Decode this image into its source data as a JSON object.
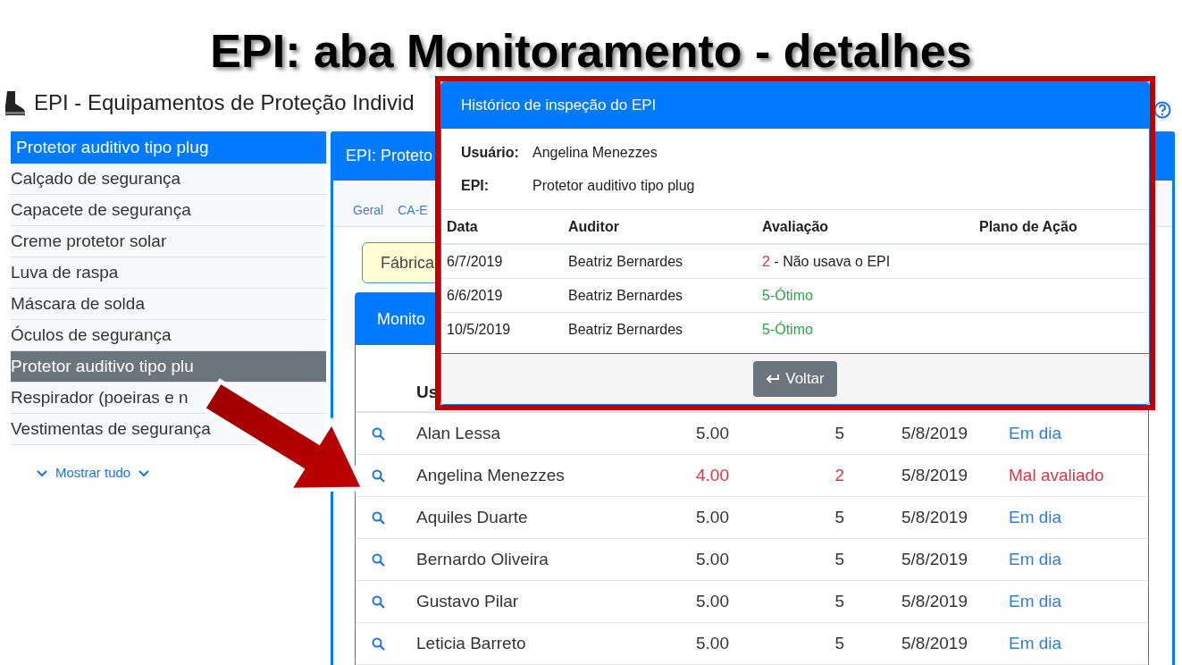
{
  "slide_title": "EPI: aba Monitoramento - detalhes",
  "app": {
    "title": "EPI - Equipamentos de Proteção Individ"
  },
  "sidebar": {
    "header": "Protetor auditivo tipo plug",
    "items": [
      {
        "label": "Calçado de segurança",
        "selected": false
      },
      {
        "label": "Capacete de segurança",
        "selected": false
      },
      {
        "label": "Creme protetor solar",
        "selected": false
      },
      {
        "label": "Luva de raspa",
        "selected": false
      },
      {
        "label": "Máscara de solda",
        "selected": false
      },
      {
        "label": "Óculos de segurança",
        "selected": false
      },
      {
        "label": "Protetor auditivo tipo plu",
        "selected": true
      },
      {
        "label": "Respirador (poeiras e n",
        "selected": false
      },
      {
        "label": "Vestimentas de segurança",
        "selected": false
      }
    ],
    "show_all": "Mostrar tudo"
  },
  "main": {
    "title": "EPI: Proteto",
    "tabs": [
      "Geral",
      "CA-E"
    ],
    "notice": "Fábrica",
    "card_title": "Monito",
    "table": {
      "columns": [
        "Us"
      ],
      "rows": [
        {
          "user": "Alan Lessa",
          "score": "5.00",
          "rating": "5",
          "date": "5/8/2019",
          "status": "Em dia",
          "flagged": false
        },
        {
          "user": "Angelina Menezzes",
          "score": "4.00",
          "rating": "2",
          "date": "5/8/2019",
          "status": "Mal avaliado",
          "flagged": true
        },
        {
          "user": "Aquiles Duarte",
          "score": "5.00",
          "rating": "5",
          "date": "5/8/2019",
          "status": "Em dia",
          "flagged": false
        },
        {
          "user": "Bernardo Oliveira",
          "score": "5.00",
          "rating": "5",
          "date": "5/8/2019",
          "status": "Em dia",
          "flagged": false
        },
        {
          "user": "Gustavo Pilar",
          "score": "5.00",
          "rating": "5",
          "date": "5/8/2019",
          "status": "Em dia",
          "flagged": false
        },
        {
          "user": "Leticia Barreto",
          "score": "5.00",
          "rating": "5",
          "date": "5/8/2019",
          "status": "Em dia",
          "flagged": false
        }
      ]
    }
  },
  "modal": {
    "title": "Histórico de inspeção do EPI",
    "fields": [
      {
        "label": "Usuário:",
        "value": "Angelina Menezzes"
      },
      {
        "label": "EPI:",
        "value": "Protetor auditivo tipo plug"
      }
    ],
    "columns": [
      "Data",
      "Auditor",
      "Avaliação",
      "Plano de Ação"
    ],
    "rows": [
      {
        "date": "6/7/2019",
        "auditor": "Beatriz Bernardes",
        "evaluation": {
          "kind": "bad",
          "score": "2",
          "note": "- Não usava o EPI"
        }
      },
      {
        "date": "6/6/2019",
        "auditor": "Beatriz Bernardes",
        "evaluation": {
          "kind": "good",
          "text": "5-Ótimo"
        }
      },
      {
        "date": "10/5/2019",
        "auditor": "Beatriz Bernardes",
        "evaluation": {
          "kind": "good",
          "text": "5-Ótimo"
        }
      }
    ],
    "button": "Voltar"
  }
}
